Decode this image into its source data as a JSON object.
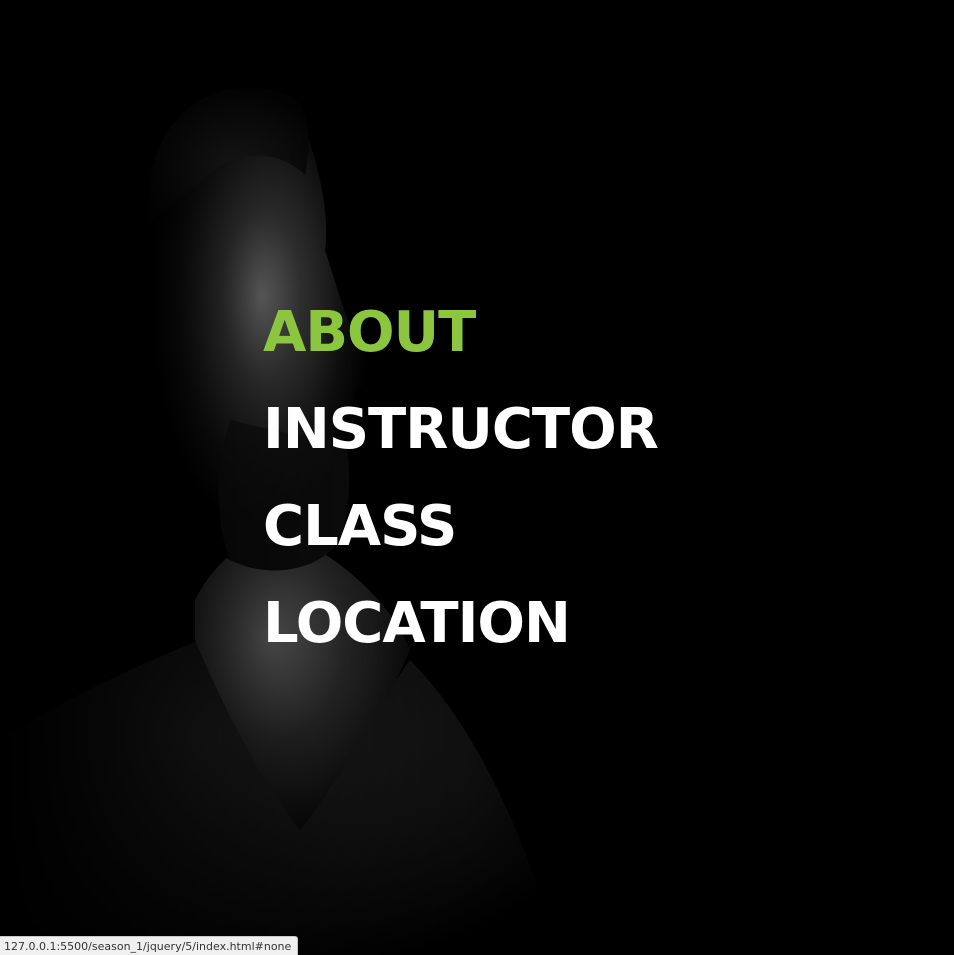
{
  "menu": {
    "items": [
      {
        "label": "ABOUT",
        "active": true
      },
      {
        "label": "INSTRUCTOR",
        "active": false
      },
      {
        "label": "CLASS",
        "active": false
      },
      {
        "label": "LOCATION",
        "active": false
      }
    ],
    "active_color": "#8cc63f",
    "default_color": "#ffffff"
  },
  "background": {
    "color": "#000000"
  },
  "status_bar": {
    "url": "127.0.0.1:5500/season_1/jquery/5/index.html#none"
  }
}
